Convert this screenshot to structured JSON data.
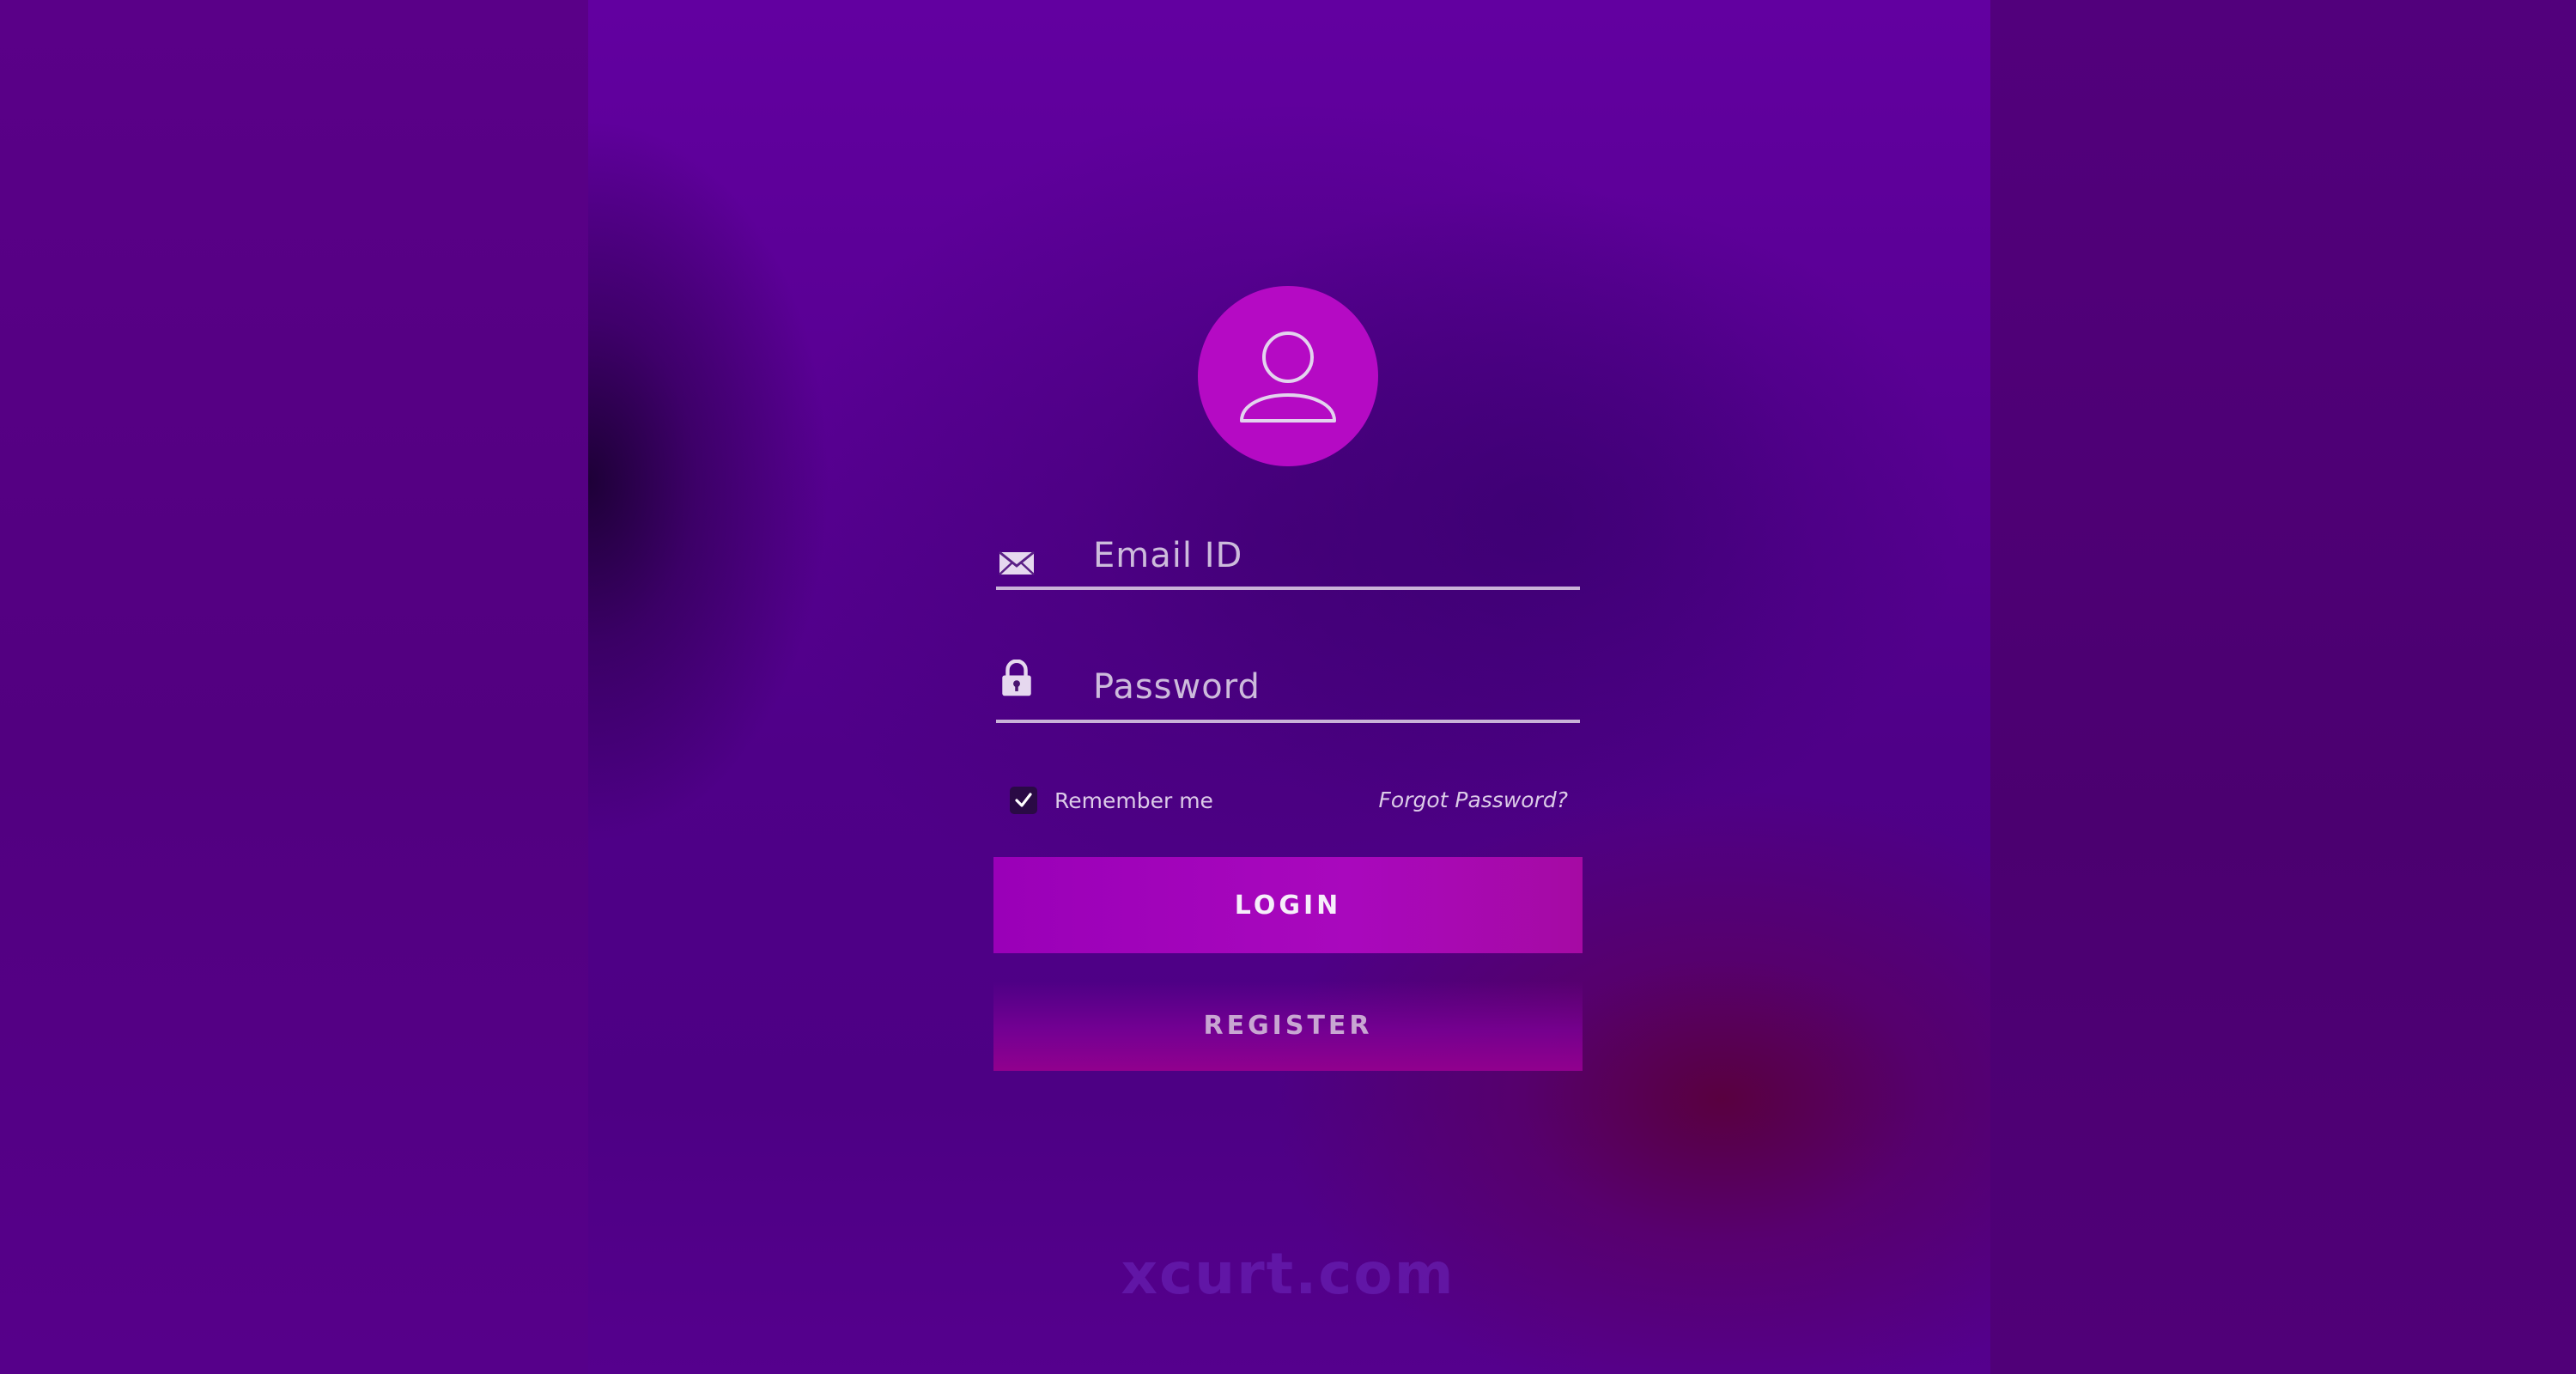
{
  "form": {
    "email": {
      "placeholder": "Email ID",
      "value": ""
    },
    "password": {
      "placeholder": "Password",
      "value": ""
    },
    "remember_label": "Remember me",
    "remember_checked": true,
    "forgot_label": "Forgot Password?",
    "login_label": "LOGIN",
    "register_label": "REGISTER"
  },
  "icons": {
    "avatar": "user-icon",
    "email": "envelope-icon",
    "password": "lock-icon",
    "checkbox": "checkmark-icon"
  },
  "watermark": "xcurt.com",
  "colors": {
    "background": "#520079",
    "accent": "#b50ac4",
    "login_button": "#a308bd",
    "register_button": "#91008e"
  }
}
